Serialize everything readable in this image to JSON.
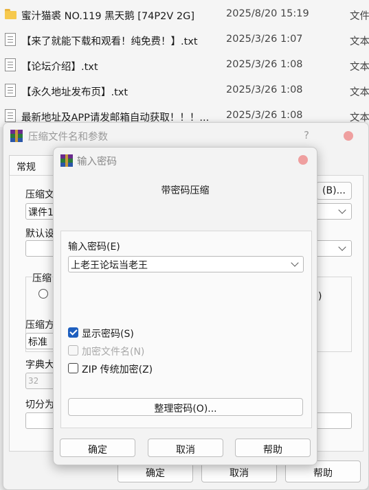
{
  "files": [
    {
      "name": "蜜汁猫裘 NO.119 黑天鹅 [74P2V 2G]",
      "date": "2025/8/20 15:19",
      "type": "文件",
      "icon": "folder-icon"
    },
    {
      "name": "【来了就能下载和观看！纯免费！】.txt",
      "date": "2025/3/26 1:07",
      "type": "文本",
      "icon": "text-file-icon"
    },
    {
      "name": "【论坛介绍】.txt",
      "date": "2025/3/26 1:08",
      "type": "文本",
      "icon": "text-file-icon"
    },
    {
      "name": "【永久地址发布页】.txt",
      "date": "2025/3/26 1:08",
      "type": "文本",
      "icon": "text-file-icon"
    },
    {
      "name": "最新地址及APP请发邮箱自动获取！！！...",
      "date": "2025/3/26 1:08",
      "type": "文本",
      "icon": "text-file-icon"
    }
  ],
  "archive_dialog": {
    "title": "压缩文件名和参数",
    "help": "?",
    "tab_general": "常规",
    "archive_name_label": "压缩文",
    "archive_name_value": "课件1",
    "browse_button": "(B)...",
    "default_label": "默认设",
    "compress_group": "压缩",
    "method_label": "压缩方",
    "method_value": "标准",
    "dict_label": "字典大",
    "dict_value": "32",
    "split_label": "切分为",
    "radio_tail": ")",
    "ok": "确定",
    "cancel": "取消",
    "help_button": "帮助"
  },
  "password_dialog": {
    "title": "输入密码",
    "subtitle": "带密码压缩",
    "password_label": "输入密码(E)",
    "password_value": "上老王论坛当老王",
    "show_password": "显示密码(S)",
    "show_password_checked": true,
    "encrypt_names": "加密文件名(N)",
    "encrypt_names_checked": false,
    "zip_legacy": "ZIP 传统加密(Z)",
    "zip_legacy_checked": false,
    "organize_button": "整理密码(O)...",
    "ok": "确定",
    "cancel": "取消",
    "help_button": "帮助"
  },
  "colors": {
    "accent": "#1e5fbf",
    "close": "#ef9f9f",
    "folder": "#f6c94e"
  }
}
